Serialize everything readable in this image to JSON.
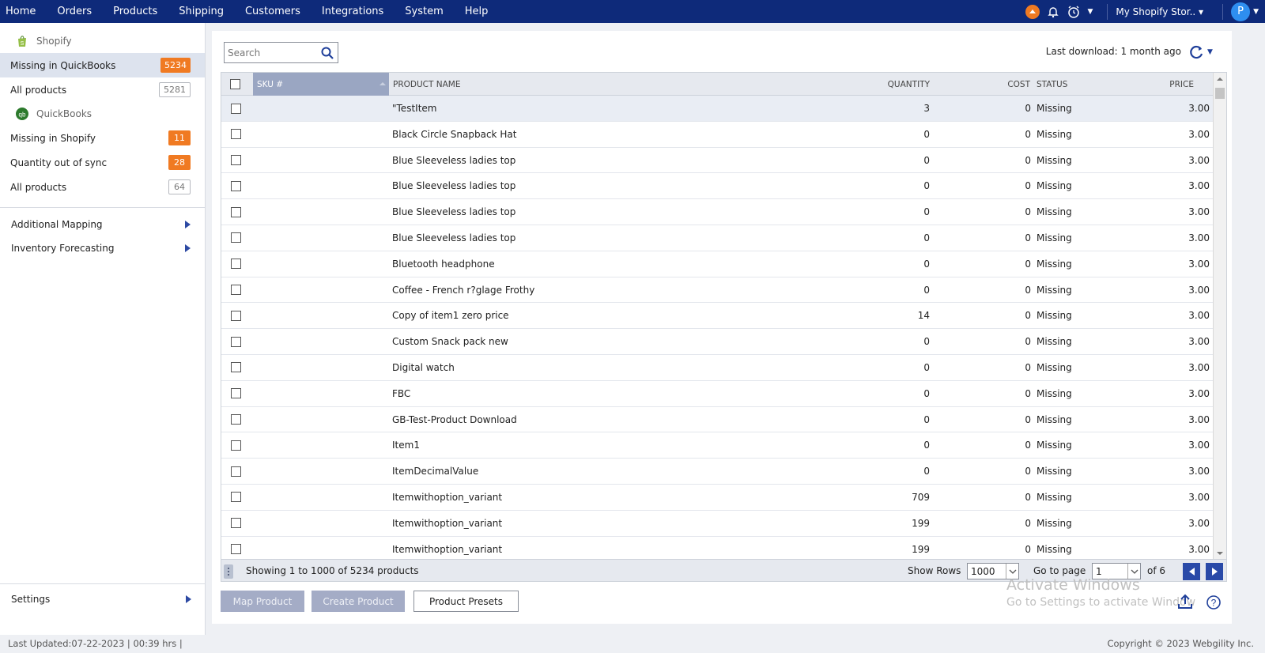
{
  "nav": {
    "items": [
      "Home",
      "Orders",
      "Products",
      "Shipping",
      "Customers",
      "Integrations",
      "System",
      "Help"
    ],
    "store": "My Shopify Stor..",
    "avatar_letter": "P",
    "colors": {
      "bar": "#0e2a7a",
      "accent": "#f07a22",
      "avatar": "#2e8ef0"
    },
    "icons": [
      "orange-app-icon",
      "bell-icon",
      "alarm-clock-icon",
      "caret-down-icon"
    ]
  },
  "sidebar": {
    "shopify_label": "Shopify",
    "quickbooks_label": "QuickBooks",
    "shopify_items": [
      {
        "label": "Missing in QuickBooks",
        "count": "5234",
        "style": "orange",
        "active": true
      },
      {
        "label": "All products",
        "count": "5281",
        "style": "gray",
        "active": false
      }
    ],
    "qb_items": [
      {
        "label": "Missing in Shopify",
        "count": "11",
        "style": "orange"
      },
      {
        "label": "Quantity out of sync",
        "count": "28",
        "style": "orange"
      },
      {
        "label": "All products",
        "count": "64",
        "style": "gray"
      }
    ],
    "links": [
      "Additional Mapping",
      "Inventory Forecasting"
    ],
    "settings": "Settings"
  },
  "main": {
    "search_placeholder": "Search",
    "last_download": "Last download: 1 month ago",
    "columns": [
      "SKU #",
      "PRODUCT NAME",
      "QUANTITY",
      "COST",
      "STATUS",
      "PRICE"
    ],
    "rows": [
      {
        "sku": "",
        "name": "\"TestItem",
        "qty": "3",
        "cost": "0",
        "status": "Missing",
        "price": "3.00"
      },
      {
        "sku": "",
        "name": "Black Circle Snapback Hat",
        "qty": "0",
        "cost": "0",
        "status": "Missing",
        "price": "3.00"
      },
      {
        "sku": "",
        "name": "Blue Sleeveless ladies top",
        "qty": "0",
        "cost": "0",
        "status": "Missing",
        "price": "3.00"
      },
      {
        "sku": "",
        "name": "Blue Sleeveless ladies top",
        "qty": "0",
        "cost": "0",
        "status": "Missing",
        "price": "3.00"
      },
      {
        "sku": "",
        "name": "Blue Sleeveless ladies top",
        "qty": "0",
        "cost": "0",
        "status": "Missing",
        "price": "3.00"
      },
      {
        "sku": "",
        "name": "Blue Sleeveless ladies top",
        "qty": "0",
        "cost": "0",
        "status": "Missing",
        "price": "3.00"
      },
      {
        "sku": "",
        "name": "Bluetooth headphone",
        "qty": "0",
        "cost": "0",
        "status": "Missing",
        "price": "3.00"
      },
      {
        "sku": "",
        "name": "Coffee - French r?glage Frothy",
        "qty": "0",
        "cost": "0",
        "status": "Missing",
        "price": "3.00"
      },
      {
        "sku": "",
        "name": "Copy of item1 zero price",
        "qty": "14",
        "cost": "0",
        "status": "Missing",
        "price": "3.00"
      },
      {
        "sku": "",
        "name": "Custom Snack pack new",
        "qty": "0",
        "cost": "0",
        "status": "Missing",
        "price": "3.00"
      },
      {
        "sku": "",
        "name": "Digital watch",
        "qty": "0",
        "cost": "0",
        "status": "Missing",
        "price": "3.00"
      },
      {
        "sku": "",
        "name": "FBC",
        "qty": "0",
        "cost": "0",
        "status": "Missing",
        "price": "3.00"
      },
      {
        "sku": "",
        "name": "GB-Test-Product Download",
        "qty": "0",
        "cost": "0",
        "status": "Missing",
        "price": "3.00"
      },
      {
        "sku": "",
        "name": "Item1",
        "qty": "0",
        "cost": "0",
        "status": "Missing",
        "price": "3.00"
      },
      {
        "sku": "",
        "name": "ItemDecimalValue",
        "qty": "0",
        "cost": "0",
        "status": "Missing",
        "price": "3.00"
      },
      {
        "sku": "",
        "name": "Itemwithoption_variant",
        "qty": "709",
        "cost": "0",
        "status": "Missing",
        "price": "3.00"
      },
      {
        "sku": "",
        "name": "Itemwithoption_variant",
        "qty": "199",
        "cost": "0",
        "status": "Missing",
        "price": "3.00"
      },
      {
        "sku": "",
        "name": "Itemwithoption_variant",
        "qty": "199",
        "cost": "0",
        "status": "Missing",
        "price": "3.00"
      }
    ],
    "footer": {
      "showing": "Showing 1 to 1000 of 5234 products",
      "show_rows_label": "Show Rows",
      "rows_value": "1000",
      "go_to_page_label": "Go to page",
      "page_value": "1",
      "of_pages": "of 6"
    },
    "buttons": {
      "map": "Map Product",
      "create": "Create Product",
      "presets": "Product Presets"
    },
    "watermark": {
      "line1": "Activate Windows",
      "line2": "Go to Settings to activate Window"
    }
  },
  "status": {
    "last_updated": "Last Updated:07-22-2023 | 00:39 hrs |",
    "copyright": "Copyright © 2023 Webgility Inc."
  }
}
